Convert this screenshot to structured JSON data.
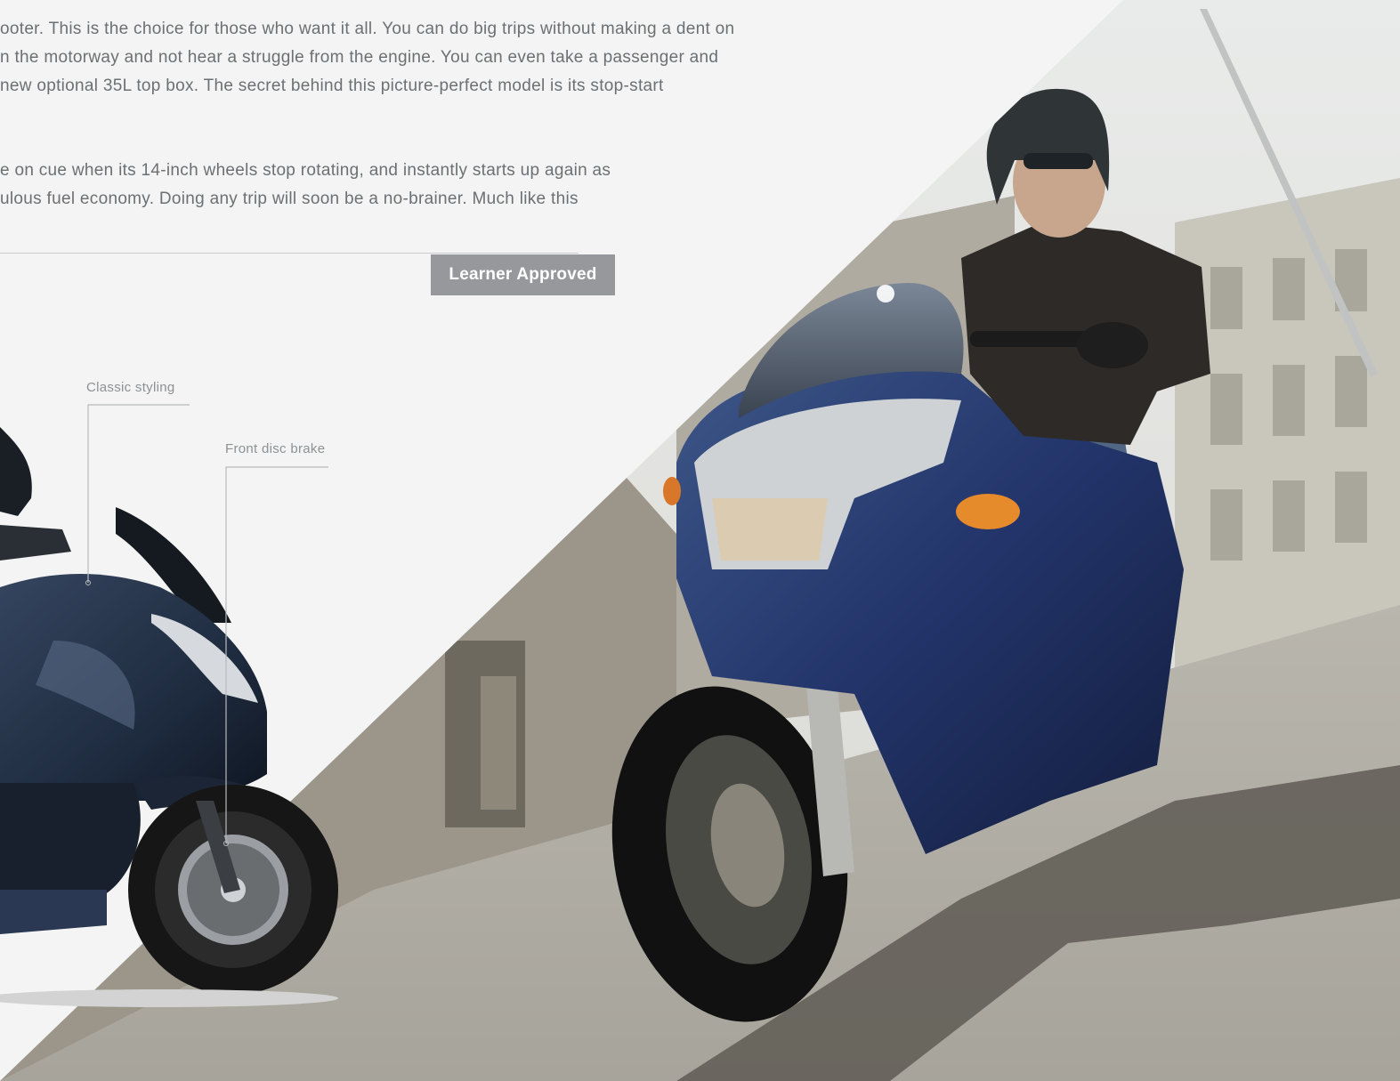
{
  "body_copy": {
    "paragraph_1": [
      "ooter. This is the choice for those who want it all. You can do big trips without making a dent on",
      "n the motorway and not hear a struggle from the engine. You can even take a passenger and",
      " new optional 35L top box. The secret behind this picture-perfect model is its stop-start"
    ],
    "paragraph_2": [
      "e on cue when its 14-inch wheels stop rotating, and instantly starts up again as",
      "ulous fuel economy. Doing any trip will soon be a no-brainer. Much like this"
    ]
  },
  "badge": {
    "label": "Learner Approved"
  },
  "callouts": {
    "classic_styling": "Classic styling",
    "front_disc_brake": "Front disc brake"
  },
  "colors": {
    "page_background": "#f3f4f3",
    "body_text": "#6d6f72",
    "badge_background": "#96989b",
    "badge_text": "#ffffff",
    "callout_text": "#8e9194",
    "scooter_body": "#1f2c40"
  }
}
